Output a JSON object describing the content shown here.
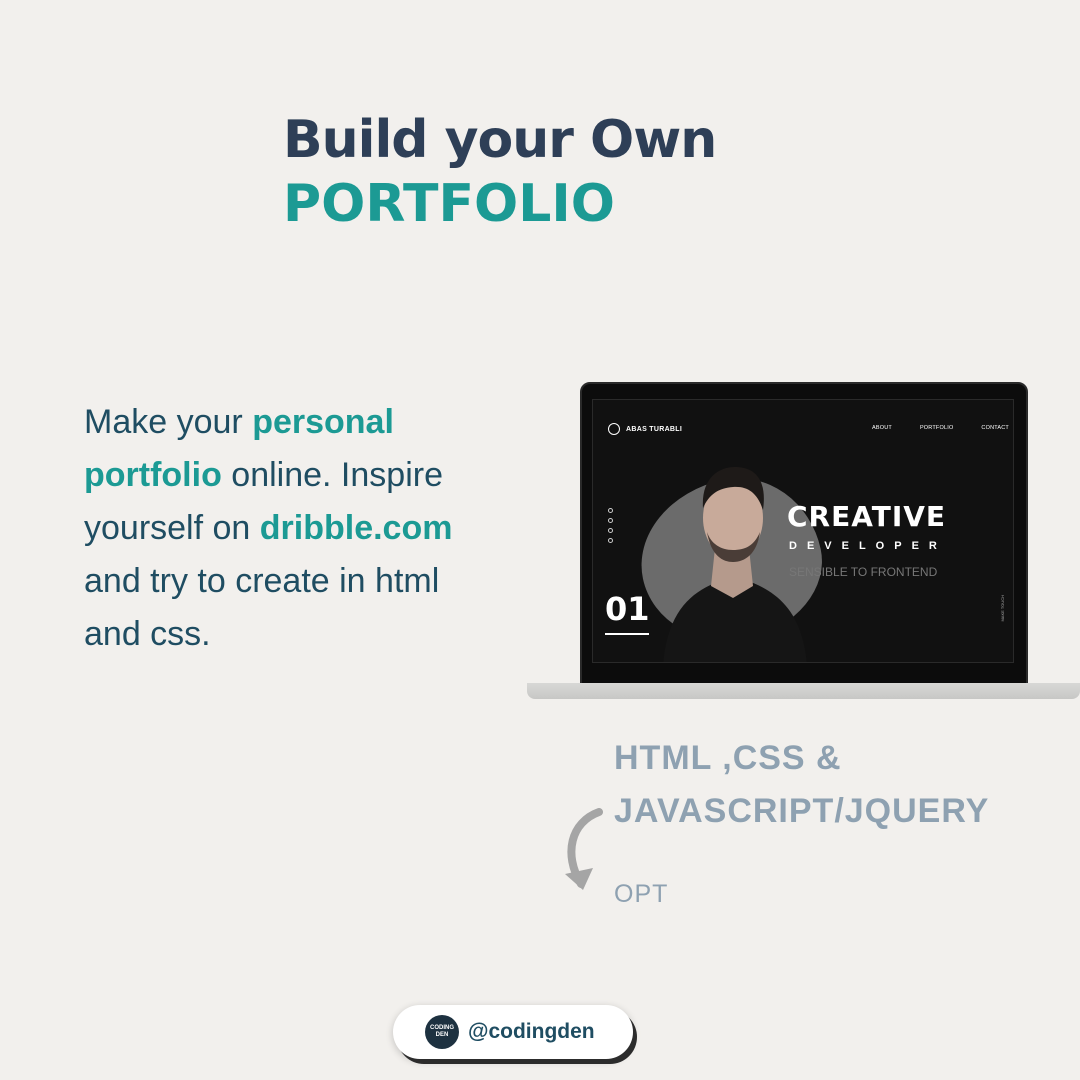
{
  "title": {
    "line1": "Build your Own",
    "line2": "PORTFOLIO"
  },
  "body": {
    "part1": "Make your ",
    "highlight1": "personal portfolio",
    "part2": " online. Inspire yourself on ",
    "highlight2": "dribble.com",
    "part3": " and try to create in html and css."
  },
  "laptop_screen": {
    "brand": "ABAS TURABLI",
    "nav": [
      "ABOUT",
      "PORTFOLIO",
      "CONTACT"
    ],
    "headline": "CREATIVE",
    "subheadline": "DEVELOPER",
    "tagline": "SENSIBLE TO FRONTEND",
    "slide_number": "01",
    "scroll_label": "MAKE TOUCH"
  },
  "tech": {
    "line1": "HTML ,CSS &",
    "line2": "JAVASCRIPT/JQUERY",
    "opt": "OPT"
  },
  "footer": {
    "logo_text": "CODING DEN",
    "handle": "@codingden"
  },
  "colors": {
    "background": "#f2f0ed",
    "title_dark": "#2e3f57",
    "accent_teal": "#1c9a94",
    "body_text": "#1f4d62",
    "muted": "#8ea1b1"
  },
  "icons": [
    "curved-arrow-icon",
    "codingden-logo-icon"
  ]
}
